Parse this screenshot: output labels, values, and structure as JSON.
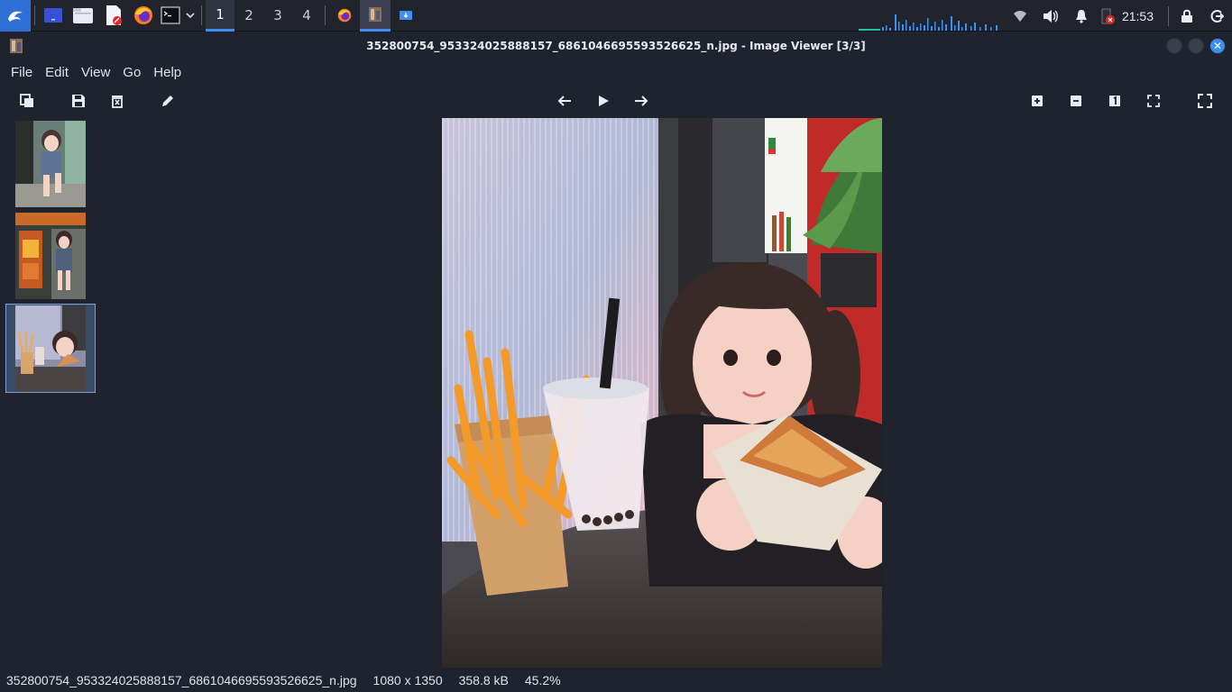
{
  "taskbar": {
    "workspaces": [
      "1",
      "2",
      "3",
      "4"
    ],
    "active_workspace": "1",
    "clock": "21:53",
    "accent": "#3d8ff2"
  },
  "window": {
    "title": "352800754_953324025888157_6861046695593526625_n.jpg - Image Viewer [3/3]"
  },
  "menu": {
    "file": "File",
    "edit": "Edit",
    "view": "View",
    "go": "Go",
    "help": "Help"
  },
  "toolbar": {
    "icons": [
      "copy-icon",
      "save-icon",
      "delete-icon",
      "edit-icon",
      "previous-icon",
      "play-icon",
      "next-icon",
      "zoom-in-icon",
      "zoom-out-icon",
      "original-size-icon",
      "fit-icon",
      "fullscreen-icon"
    ]
  },
  "thumbnails": {
    "count": 3,
    "selected_index": 3
  },
  "status": {
    "filename": "352800754_953324025888157_6861046695593526625_n.jpg",
    "dimensions": "1080 x 1350",
    "filesize": "358.8 kB",
    "zoom": "45.2%"
  }
}
